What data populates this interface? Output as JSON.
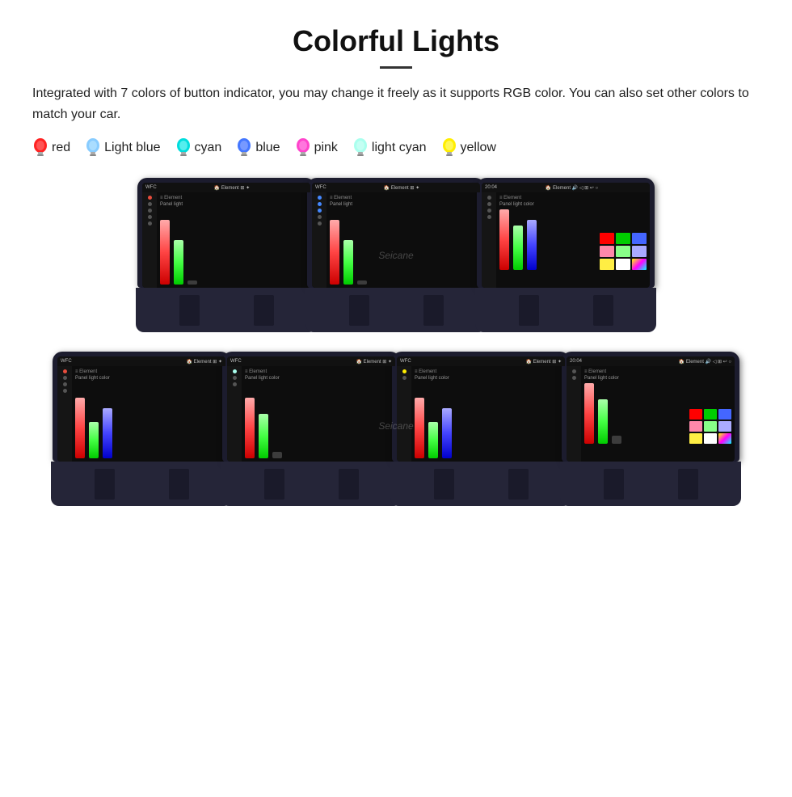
{
  "page": {
    "title": "Colorful Lights",
    "description": "Integrated with 7 colors of button indicator, you may change it freely as it supports RGB color. You can also set other colors to match your car.",
    "colors": [
      {
        "name": "red",
        "color": "#ff2222",
        "icon": "bulb"
      },
      {
        "name": "Light blue",
        "color": "#88ccff",
        "icon": "bulb"
      },
      {
        "name": "cyan",
        "color": "#00ffff",
        "icon": "bulb"
      },
      {
        "name": "blue",
        "color": "#4488ff",
        "icon": "bulb"
      },
      {
        "name": "pink",
        "color": "#ff44cc",
        "icon": "bulb"
      },
      {
        "name": "light cyan",
        "color": "#aaffee",
        "icon": "bulb"
      },
      {
        "name": "yellow",
        "color": "#ffee00",
        "icon": "bulb"
      }
    ],
    "watermark": "Seicane",
    "top_row_count": 3,
    "bottom_row_count": 4
  }
}
